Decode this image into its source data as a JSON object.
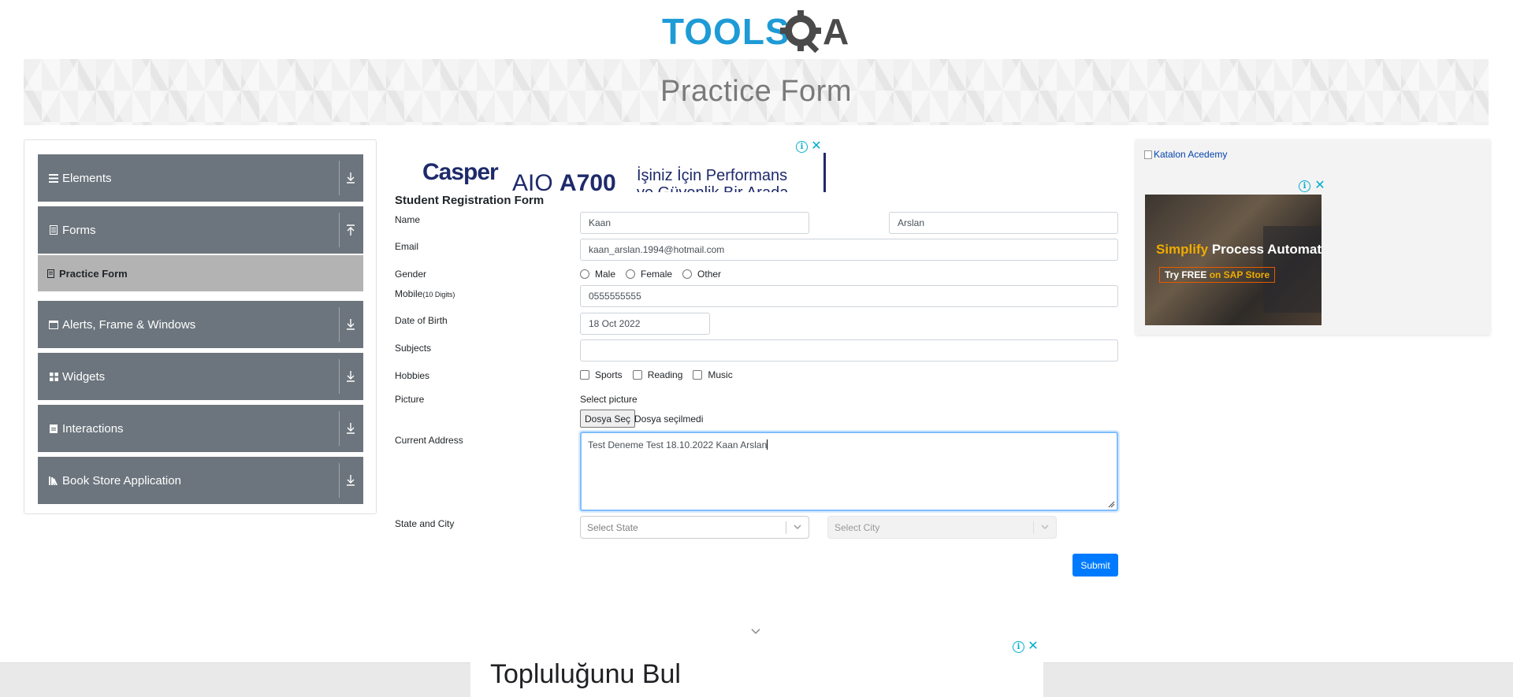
{
  "logo": {
    "text_left": "TOOLS",
    "text_right": "A",
    "colors": {
      "tools": "#1e9bd7",
      "qa": "#4a4a4a"
    }
  },
  "banner": {
    "title": "Practice Form"
  },
  "sidebar": {
    "groups": [
      {
        "label": "Elements",
        "icon": "list-icon",
        "arrow": "expand-icon"
      },
      {
        "label": "Forms",
        "icon": "document-icon",
        "arrow": "collapse-icon"
      },
      {
        "label": "Alerts, Frame & Windows",
        "icon": "window-icon",
        "arrow": "expand-icon"
      },
      {
        "label": "Widgets",
        "icon": "grid-icon",
        "arrow": "expand-icon"
      },
      {
        "label": "Interactions",
        "icon": "interaction-icon",
        "arrow": "expand-icon"
      },
      {
        "label": "Book Store Application",
        "icon": "books-icon",
        "arrow": "expand-icon"
      }
    ],
    "active_item": {
      "label": "Practice Form",
      "icon": "document-icon"
    },
    "colors": {
      "group_bg": "#6c757d",
      "active_bg": "#b3b3b3"
    }
  },
  "ad_top": {
    "brand": "Casper",
    "model_prefix": "AIO ",
    "model": "A700",
    "line1": "İşiniz İçin Performans",
    "line2": "ve Güvenlik Bir Arada"
  },
  "form": {
    "title": "Student Registration Form",
    "labels": {
      "name": "Name",
      "email": "Email",
      "gender": "Gender",
      "mobile": "Mobile",
      "mobile_hint": "(10 Digits)",
      "dob": "Date of Birth",
      "subjects": "Subjects",
      "hobbies": "Hobbies",
      "picture": "Picture",
      "address": "Current Address",
      "state_city": "State and City"
    },
    "values": {
      "first_name": "Kaan",
      "last_name": "Arslan",
      "email": "kaan_arslan.1994@hotmail.com",
      "mobile": "0555555555",
      "dob": "18 Oct 2022",
      "subjects": "",
      "address": "Test Deneme Test 18.10.2022 Kaan Arslan"
    },
    "gender_options": [
      "Male",
      "Female",
      "Other"
    ],
    "hobby_options": [
      "Sports",
      "Reading",
      "Music"
    ],
    "picture": {
      "label": "Select picture",
      "button": "Dosya Seç",
      "status": "Dosya seçilmedi"
    },
    "state_placeholder": "Select State",
    "city_placeholder": "Select City",
    "submit": "Submit",
    "colors": {
      "submit_bg": "#007bff",
      "focus_border": "#80bdff"
    }
  },
  "ad_right": {
    "broken_image_alt": "Katalon Acedemy",
    "headline_accent": "Simplify",
    "headline_rest": " Process Automatio",
    "cta_plain": "Try FREE ",
    "cta_accent": "on SAP Store"
  },
  "ad_bottom": {
    "text": "Topluluğunu Bul"
  }
}
